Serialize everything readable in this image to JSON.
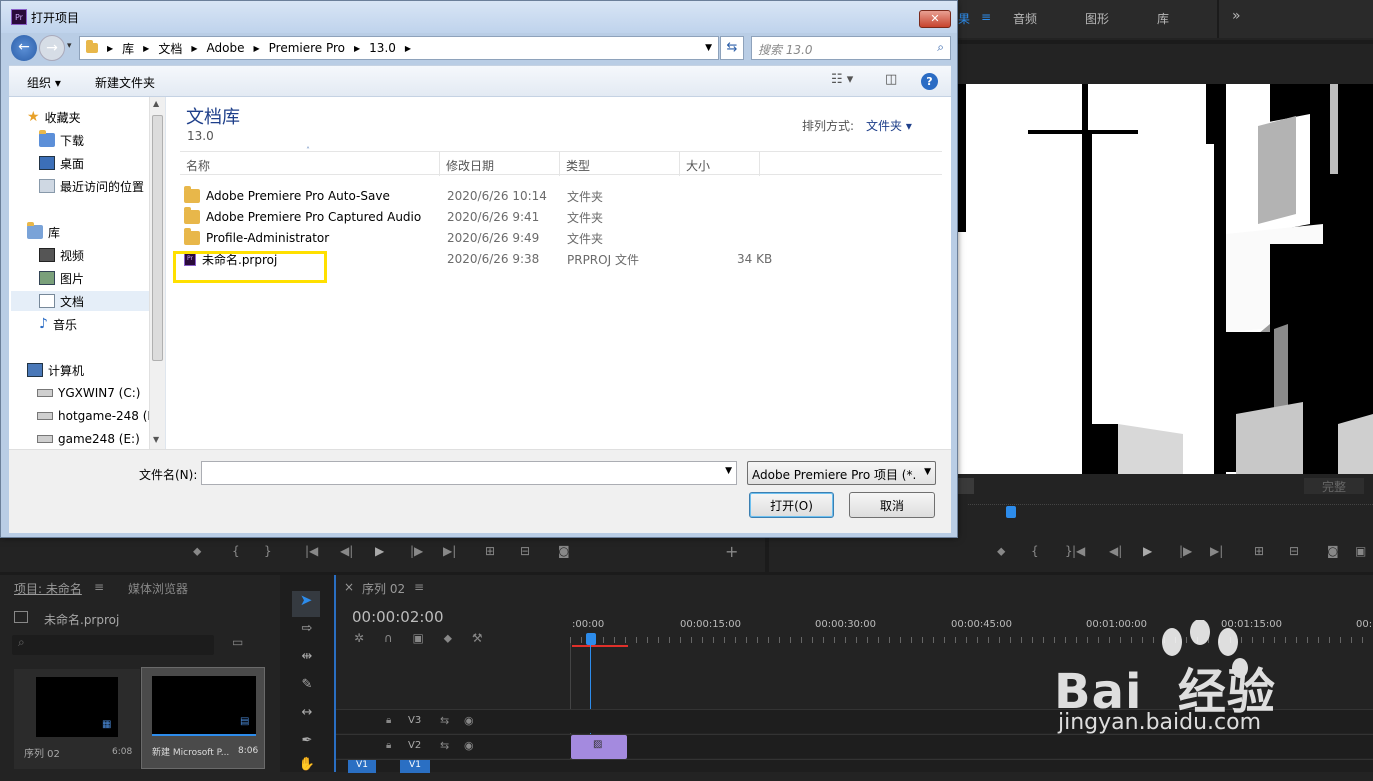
{
  "premiere": {
    "nav_tabs": [
      "果",
      "音频",
      "图形",
      "库"
    ],
    "more_glyph": "»",
    "program_zoom": "完整",
    "project_panel": {
      "tab_project": "项目: 未命名",
      "tab_media": "媒体浏览器",
      "project_file": "未命名.prproj",
      "bins": [
        {
          "name": "序列 02",
          "duration": "6:08"
        },
        {
          "name": "新建 Microsoft P...",
          "duration": "8:06"
        }
      ]
    },
    "timeline": {
      "close": "×",
      "sequence_name": "序列 02",
      "menu_glyph": "≡",
      "timecode": "00:00:02:00",
      "ruler": [
        ":00:00",
        "00:00:15:00",
        "00:00:30:00",
        "00:00:45:00",
        "00:01:00:00",
        "00:01:15:00",
        "00:"
      ],
      "tracks": [
        "V3",
        "V2",
        "V1"
      ],
      "source_patch": "V1"
    }
  },
  "dialog": {
    "title": "打开项目",
    "close_glyph": "✕",
    "breadcrumb": [
      "库",
      "文档",
      "Adobe",
      "Premiere Pro",
      "13.0"
    ],
    "search_placeholder": "搜索 13.0",
    "organize_label": "组织 ▾",
    "new_folder_label": "新建文件夹",
    "nav": {
      "favorites_header": "收藏夹",
      "favorites": [
        "下载",
        "桌面",
        "最近访问的位置"
      ],
      "libraries_header": "库",
      "libraries": [
        "视频",
        "图片",
        "文档",
        "音乐"
      ],
      "computer_header": "计算机",
      "drives": [
        "YGXWIN7 (C:)",
        "hotgame-248 (D",
        "game248 (E:)"
      ]
    },
    "library": {
      "title": "文档库",
      "subtitle": "13.0",
      "arrange_label": "排列方式:",
      "arrange_value": "文件夹 ▾"
    },
    "columns": {
      "name": "名称",
      "date": "修改日期",
      "type": "类型",
      "size": "大小"
    },
    "files": [
      {
        "name": "Adobe Premiere Pro Auto-Save",
        "date": "2020/6/26 10:14",
        "type": "文件夹",
        "size": "",
        "icon": "folder-icon"
      },
      {
        "name": "Adobe Premiere Pro Captured Audio",
        "date": "2020/6/26 9:41",
        "type": "文件夹",
        "size": "",
        "icon": "folder-icon"
      },
      {
        "name": "Profile-Administrator",
        "date": "2020/6/26 9:49",
        "type": "文件夹",
        "size": "",
        "icon": "folder-icon"
      },
      {
        "name": "未命名.prproj",
        "date": "2020/6/26 9:38",
        "type": "PRPROJ 文件",
        "size": "34 KB",
        "icon": "premiere-file-icon"
      }
    ],
    "highlight_color": "#ffe000",
    "filename_label": "文件名(N):",
    "filename_value": "",
    "filetype_value": "Adobe Premiere Pro 项目 (*.",
    "open_button": "打开(O)",
    "cancel_button": "取消"
  },
  "watermark": {
    "brand": "Bai  经验",
    "url": "jingyan.baidu.com"
  }
}
